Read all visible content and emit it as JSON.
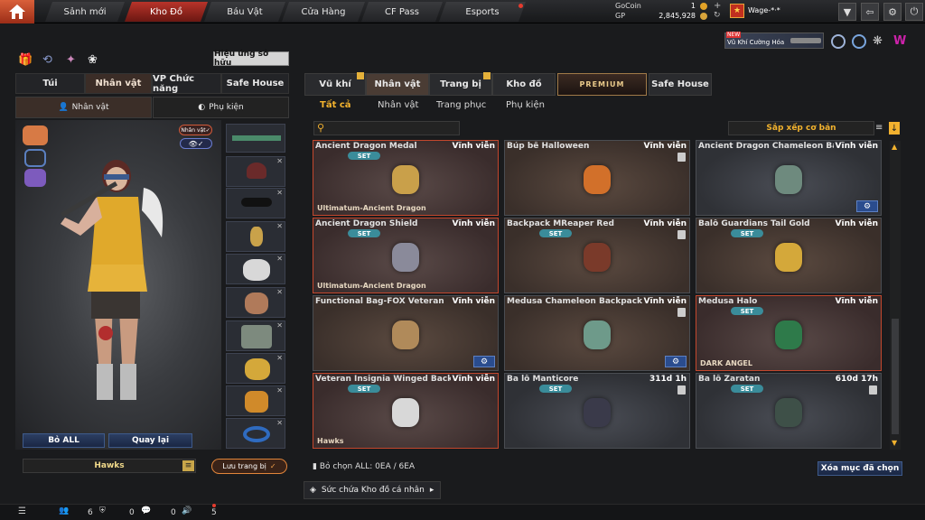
{
  "nav": {
    "tabs": [
      {
        "label": "Sảnh mới"
      },
      {
        "label": "Kho Đồ"
      },
      {
        "label": "Báu Vật"
      },
      {
        "label": "Cửa Hàng"
      },
      {
        "label": "CF Pass"
      },
      {
        "label": "Esports"
      }
    ],
    "active": "Kho Đồ"
  },
  "currency": {
    "gocoin_label": "GoCoin",
    "gocoin_value": "1",
    "gp_label": "GP",
    "gp_value": "2,845,928"
  },
  "user": {
    "name": "Wage-*·*"
  },
  "promo": {
    "badge": "NEW",
    "text": "Vũ Khí Cường Hóa"
  },
  "left": {
    "effect_button": "Hiệu ứng sở hữu",
    "tabs": [
      {
        "label": "Túi"
      },
      {
        "label": "Nhân vật"
      },
      {
        "label": "VP Chức năng"
      },
      {
        "label": "Safe House"
      }
    ],
    "subtabs": [
      {
        "label": "Nhân vật"
      },
      {
        "label": "Phụ kiện"
      }
    ],
    "char_badge": "Nhân vật✓",
    "buttons": {
      "remove_all": "Bỏ ALL",
      "back": "Quay lại"
    },
    "clan_name": "Hawks",
    "save_outfit": "Lưu trang bị"
  },
  "right": {
    "tabs": [
      {
        "label": "Vũ khí"
      },
      {
        "label": "Nhân vật"
      },
      {
        "label": "Trang bị"
      },
      {
        "label": "Kho đồ"
      },
      {
        "label": "PREMIUM"
      },
      {
        "label": "Safe House"
      }
    ],
    "subtabs": [
      {
        "label": "Tất cả"
      },
      {
        "label": "Nhân vật"
      },
      {
        "label": "Trang phục"
      },
      {
        "label": "Phụ kiện"
      }
    ],
    "sort_label": "Sắp xếp cơ bản",
    "items": [
      {
        "name": "Ancient Dragon Medal",
        "duration": "Vĩnh viễn",
        "set": "SET",
        "group": "Ultimatum-Ancient Dragon"
      },
      {
        "name": "Búp bê Halloween",
        "duration": "Vĩnh viễn"
      },
      {
        "name": "Ancient Dragon Chameleon Backpack",
        "duration": "Vĩnh viễn"
      },
      {
        "name": "Ancient Dragon Shield",
        "duration": "Vĩnh viễn",
        "set": "SET",
        "group": "Ultimatum-Ancient Dragon"
      },
      {
        "name": "Backpack MReaper Red",
        "duration": "Vĩnh viễn",
        "set": "SET"
      },
      {
        "name": "Balô Guardians Tail Gold",
        "duration": "Vĩnh viễn",
        "set": "SET"
      },
      {
        "name": "Functional Bag-FOX Veteran",
        "duration": "Vĩnh viễn"
      },
      {
        "name": "Medusa Chameleon Backpack",
        "duration": "Vĩnh viễn"
      },
      {
        "name": "Medusa Halo",
        "duration": "Vĩnh viễn",
        "set": "SET",
        "group": "DARK ANGEL"
      },
      {
        "name": "Veteran Insignia Winged Backpack",
        "duration": "Vĩnh viễn",
        "set": "SET",
        "group": "Hawks"
      },
      {
        "name": "Ba lô Manticore",
        "duration": "311d 1h",
        "set": "SET"
      },
      {
        "name": "Ba lô Zaratan",
        "duration": "610d 17h",
        "set": "SET"
      }
    ],
    "selection_text": "Bỏ chọn ALL: 0EA / 6EA",
    "delete_selected": "Xóa mục đã chọn",
    "capacity": "Sức chứa Kho đồ cá nhân"
  },
  "bottom": {
    "count1": "6",
    "count2": "0",
    "count3": "0",
    "count4": "5"
  }
}
